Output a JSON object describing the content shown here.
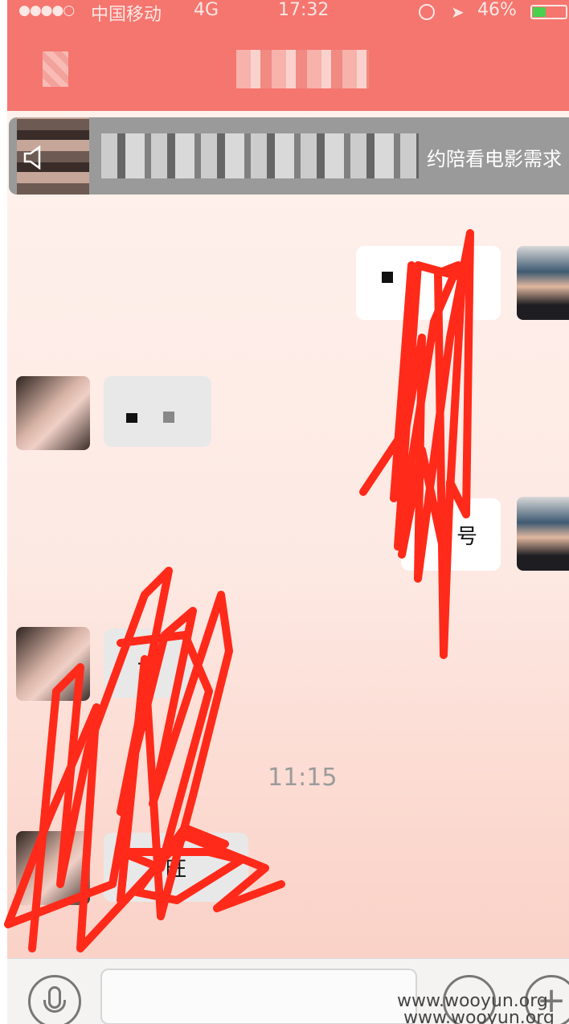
{
  "status_bar": {
    "signal": "●●●●○",
    "carrier": "中国移动",
    "network": "4G",
    "time": "17:32",
    "battery": "46%"
  },
  "voice_banner": {
    "text": "约陪看电影需求"
  },
  "messages": [
    {
      "from": "me",
      "text": "",
      "note": "blurred"
    },
    {
      "from": "her",
      "text": ""
    },
    {
      "from": "me",
      "text": "号"
    },
    {
      "from": "her",
      "text": "一"
    },
    {
      "from": "her",
      "text": "旺"
    }
  ],
  "timestamp": "11:15",
  "watermark": "www.wooyun.org",
  "colors": {
    "header": "#f5766f",
    "annotation_red": "#ff2a1a",
    "battery_green": "#49d04f"
  },
  "icons": {
    "mic": "microphone-icon",
    "emoji": "emoji-icon",
    "plus": "plus-icon",
    "speaker": "speaker-icon"
  }
}
